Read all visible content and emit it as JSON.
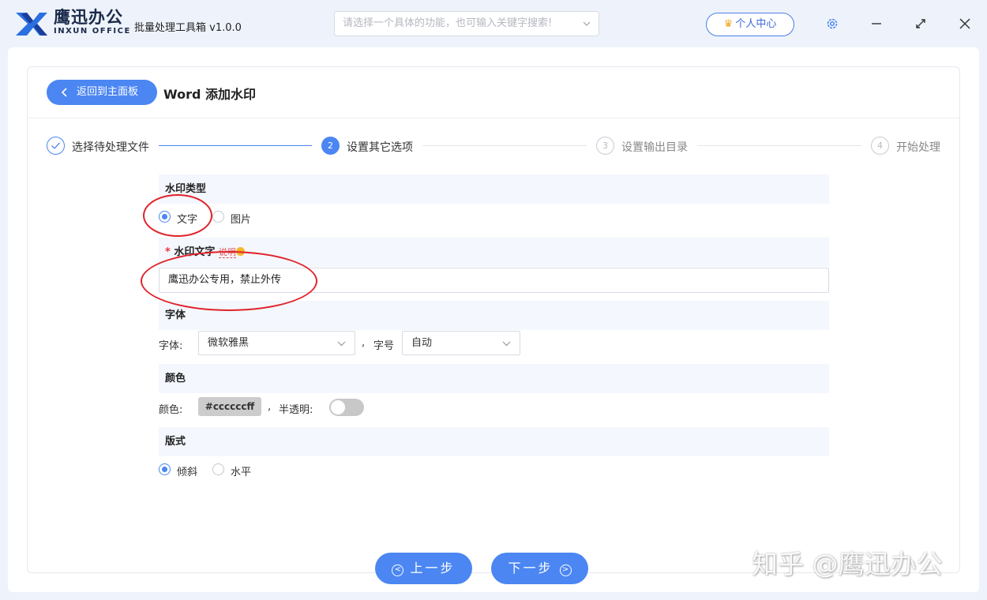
{
  "app": {
    "logo_cn": "鹰迅办公",
    "logo_en": "INXUN OFFICE",
    "name": "批量处理工具箱 v1.0.0",
    "search_placeholder": "请选择一个具体的功能，也可输入关键字搜索!",
    "user_center": "个人中心",
    "icons": [
      "logo-mark",
      "chevron-down-icon",
      "crown-icon",
      "gear-icon",
      "minimize-icon",
      "maximize-icon",
      "close-icon"
    ]
  },
  "page": {
    "back_label": "返回到主面板",
    "title": "Word 添加水印"
  },
  "steps": [
    {
      "num": "",
      "label": "选择待处理文件",
      "state": "done"
    },
    {
      "num": "2",
      "label": "设置其它选项",
      "state": "active"
    },
    {
      "num": "3",
      "label": "设置输出目录",
      "state": "pending"
    },
    {
      "num": "4",
      "label": "开始处理",
      "state": "pending"
    }
  ],
  "form": {
    "type": {
      "heading": "水印类型",
      "options": [
        {
          "label": "文字",
          "checked": true
        },
        {
          "label": "图片",
          "checked": false
        }
      ]
    },
    "text": {
      "required_mark": "*",
      "heading": "水印文字",
      "tip": "说明",
      "value": "鹰迅办公专用，禁止外传"
    },
    "font": {
      "heading": "字体",
      "family_label": "字体:",
      "family_value": "微软雅黑",
      "separator": ",",
      "size_label": "字号",
      "size_value": "自动"
    },
    "color": {
      "heading": "颜色",
      "color_label": "颜色:",
      "color_value": "#ccccccff",
      "separator": ",",
      "translucent_label": "半透明:",
      "translucent_on": false
    },
    "layout": {
      "heading": "版式",
      "options": [
        {
          "label": "倾斜",
          "checked": true
        },
        {
          "label": "水平",
          "checked": false
        }
      ]
    }
  },
  "nav": {
    "prev_label": "上一步",
    "next_label": "下一步"
  },
  "watermark": "知乎 @鹰迅办公",
  "colors": {
    "accent": "#4b86f2",
    "annotation": "#e0222a",
    "section_bg": "#f4f7fd"
  }
}
